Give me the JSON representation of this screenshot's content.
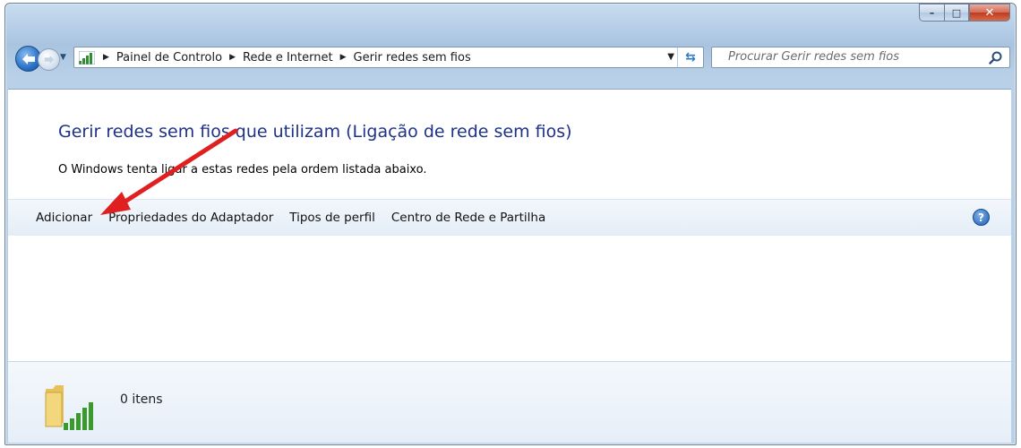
{
  "window": {
    "caption_buttons": {
      "minimize": "minimize-icon",
      "maximize": "maximize-icon",
      "close": "close-icon"
    }
  },
  "navigation": {
    "breadcrumbs": [
      "Painel de Controlo",
      "Rede e Internet",
      "Gerir redes sem fios"
    ],
    "search_placeholder": "Procurar Gerir redes sem fios"
  },
  "page": {
    "heading": "Gerir redes sem fios que utilizam (Ligação de rede sem fios)",
    "description": "O Windows tenta ligar a estas redes pela ordem listada abaixo."
  },
  "toolbar": {
    "items": [
      "Adicionar",
      "Propriedades do Adaptador",
      "Tipos de perfil",
      "Centro de Rede e Partilha"
    ],
    "help_icon": "help-icon"
  },
  "details_pane": {
    "item_count": "0 itens"
  },
  "colors": {
    "heading": "#1e3287",
    "annotation_arrow": "#e02020",
    "titlebar": "#bcd3ea"
  }
}
